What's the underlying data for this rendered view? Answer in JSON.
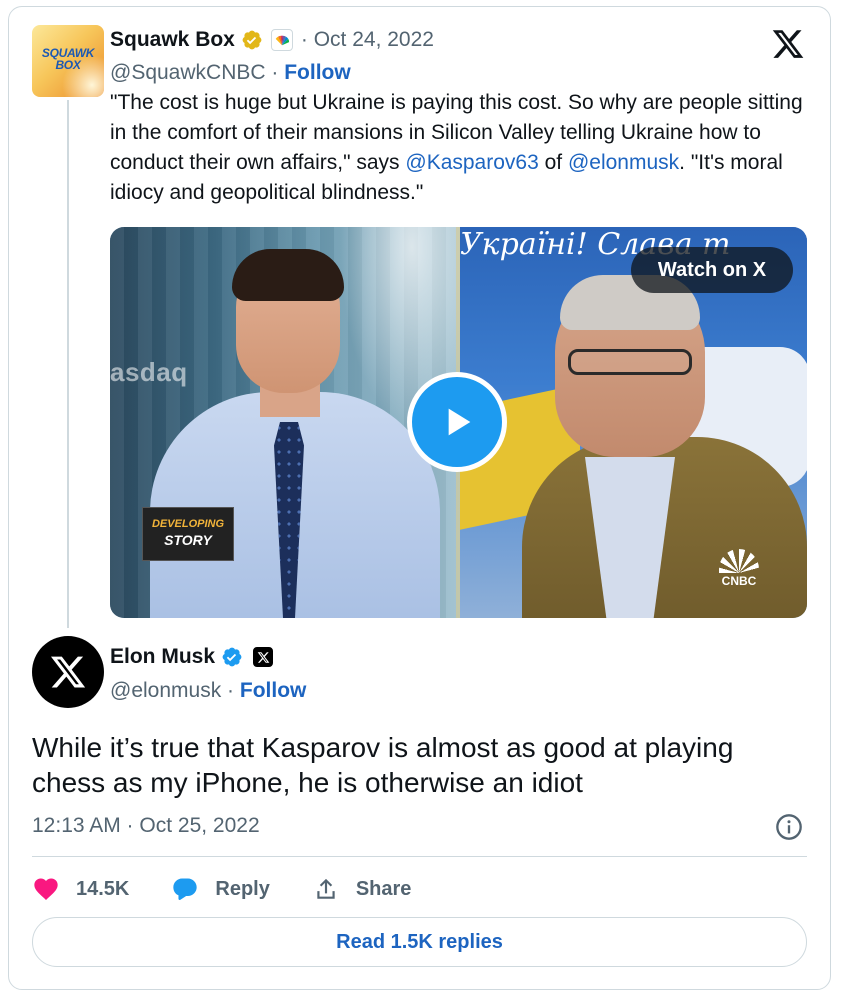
{
  "quoted_tweet": {
    "avatar_text": "SQUAWK BOX",
    "name": "Squawk Box",
    "verified_type": "gold-check",
    "affiliate": "nbc-peacock",
    "date": "· Oct 24, 2022",
    "handle": "@SquawkCNBC",
    "separator": " · ",
    "follow_label": "Follow",
    "text_parts": {
      "p1": "\"The cost is huge but Ukraine is paying this cost. So why are people sitting in the comfort of their mansions in Silicon Valley telling Ukraine how to conduct their own affairs,\" says ",
      "mention1": "@Kasparov63",
      "p2": " of ",
      "mention2": "@elonmusk",
      "p3": ". \"It's moral idiocy and geopolitical blindness.\""
    },
    "media": {
      "watch_label": "Watch on X",
      "banner_line1": "DEVELOPING",
      "banner_line2": "STORY",
      "backdrop_text_left": "asdaq",
      "backdrop_text_right": "Україні!   Слава т",
      "network_logo": "CNBC"
    }
  },
  "main_tweet": {
    "name": "Elon Musk",
    "verified_type": "blue-check",
    "affiliate": "x-logo",
    "handle": "@elonmusk",
    "separator": " · ",
    "follow_label": "Follow",
    "text": "While it’s true that Kasparov is almost as good at playing chess as my iPhone, he is otherwise an idiot",
    "timestamp": "12:13 AM · Oct 25, 2022",
    "actions": {
      "likes": "14.5K",
      "reply_label": "Reply",
      "share_label": "Share"
    },
    "read_replies_label": "Read 1.5K replies"
  },
  "colors": {
    "link": "#1d64c0",
    "muted": "#536471",
    "border": "#cfd9de",
    "heart": "#f91880",
    "reply_icon": "#1d9bf0",
    "gold": "#e2b719",
    "blue_check": "#1d9bf0"
  },
  "icons": [
    "x-logo-icon",
    "gold-verified-icon",
    "blue-verified-icon",
    "nbc-peacock-icon",
    "play-icon",
    "info-icon",
    "heart-icon",
    "reply-icon",
    "share-icon"
  ]
}
